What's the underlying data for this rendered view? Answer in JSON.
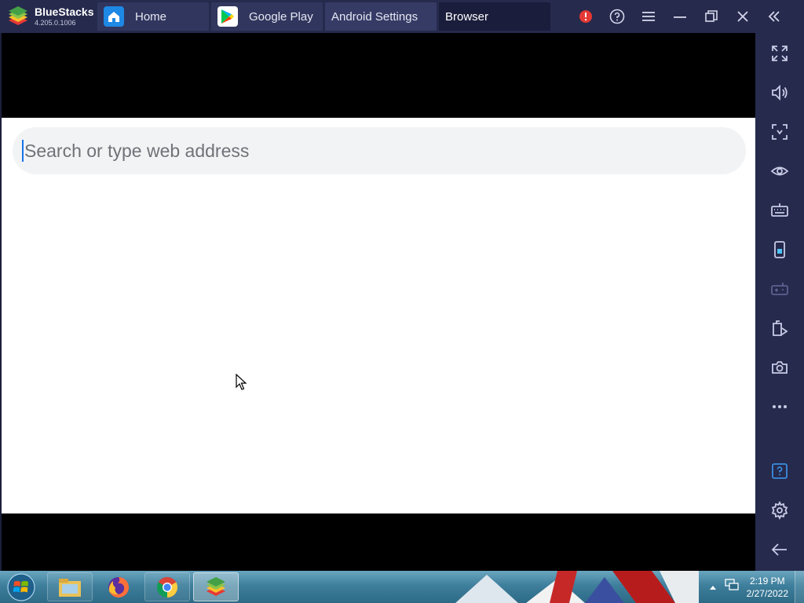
{
  "app": {
    "name": "BlueStacks",
    "version": "4.205.0.1006"
  },
  "tabs": [
    {
      "label": "Home",
      "icon": "home-icon"
    },
    {
      "label": "Google Play",
      "icon": "google-play-icon"
    },
    {
      "label": "Android Settings"
    },
    {
      "label": "Browser"
    }
  ],
  "title_controls": [
    "alert-icon",
    "help-icon",
    "menu-icon",
    "minimize-icon",
    "restore-icon",
    "close-icon",
    "collapse-sidebar-icon"
  ],
  "browser": {
    "search_placeholder": "Search or type web address",
    "search_value": ""
  },
  "sidebar": {
    "items": [
      "fullscreen-icon",
      "volume-icon",
      "screen-select-icon",
      "eye-icon",
      "keyboard-icon",
      "phone-icon",
      "gamepad-icon",
      "multi-instance-icon",
      "camera-icon",
      "more-icon",
      "help-square-icon",
      "settings-icon",
      "back-arrow-icon"
    ]
  },
  "taskbar": {
    "time": "2:19 PM",
    "date": "2/27/2022",
    "apps": [
      "file-explorer-icon",
      "firefox-icon",
      "chrome-icon",
      "bluestacks-icon"
    ]
  },
  "colors": {
    "titlebar": "#262a4d",
    "tab_active": "#1a1d3c",
    "alert": "#e53935",
    "caret": "#1a73e8"
  }
}
